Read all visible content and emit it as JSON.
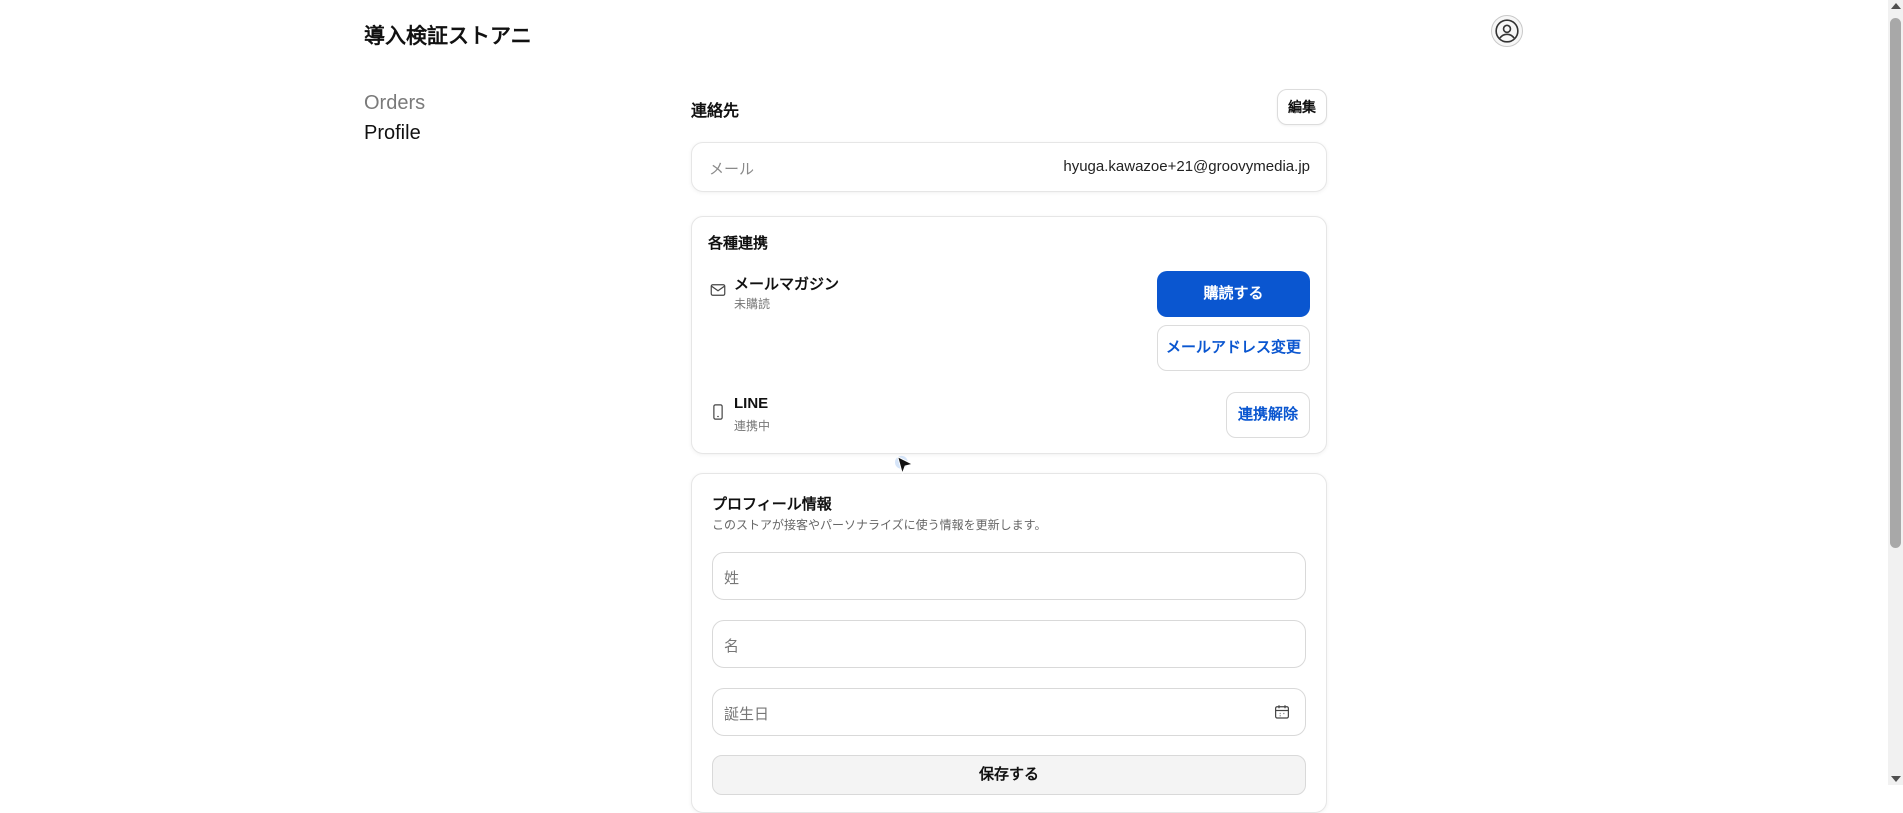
{
  "header": {
    "store_name": "導入検証ストアニ",
    "account_icon": "user-circle-icon"
  },
  "nav": {
    "items": [
      {
        "label": "Orders",
        "active": false
      },
      {
        "label": "Profile",
        "active": true
      }
    ]
  },
  "contact": {
    "title": "連絡先",
    "edit_label": "編集",
    "email_label": "メール",
    "email_value": "hyuga.kawazoe+21@groovymedia.jp"
  },
  "integrations": {
    "title": "各種連携",
    "newsletter": {
      "icon": "mail-icon",
      "name": "メールマガジン",
      "status": "未購読",
      "subscribe_label": "購読する",
      "change_email_label": "メールアドレス変更"
    },
    "line": {
      "icon": "phone-icon",
      "name": "LINE",
      "status": "連携中",
      "unlink_label": "連携解除"
    }
  },
  "profile": {
    "title": "プロフィール情報",
    "description": "このストアが接客やパーソナライズに使う情報を更新します。",
    "last_name_placeholder": "姓",
    "first_name_placeholder": "名",
    "birthday_placeholder": "誕生日",
    "save_label": "保存する"
  },
  "colors": {
    "primary": "#0a56d0",
    "border": "#dcdcdc",
    "text_muted": "#777777"
  }
}
